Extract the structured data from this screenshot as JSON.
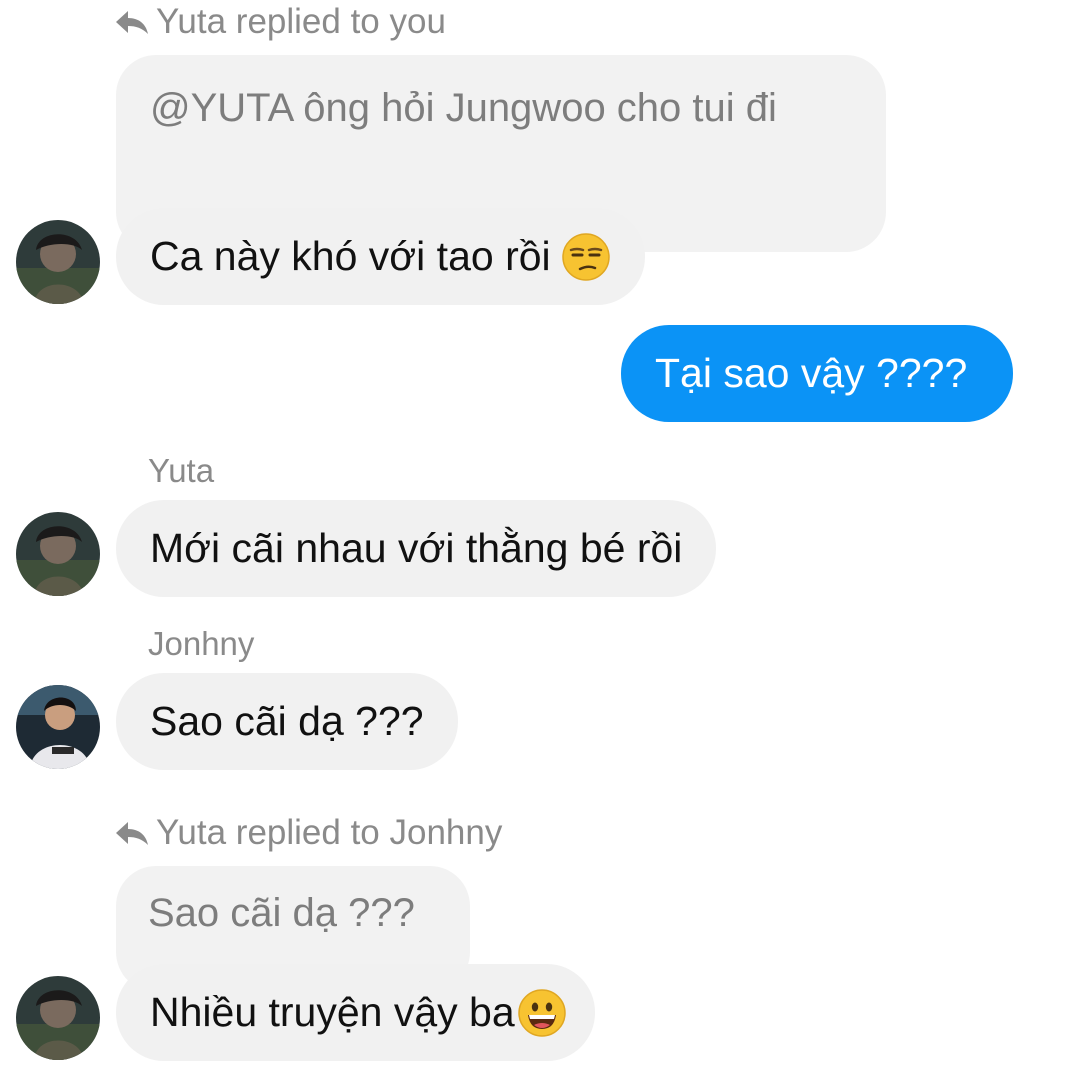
{
  "messages": {
    "m1_reply_meta": "Yuta replied to you",
    "m1_quote": "@YUTA ông hỏi Jungwoo cho tui đi",
    "m1_text": "Ca này khó với tao rồi",
    "m1_emoji": "unamused-face-emoji",
    "m2_text": "Tại sao vậy ????",
    "m3_sender": "Yuta",
    "m3_text": "Mới cãi nhau với thằng bé rồi",
    "m4_sender": "Jonhny",
    "m4_text": "Sao cãi dạ ???",
    "m5_reply_meta": "Yuta replied to Jonhny",
    "m5_quote": "Sao cãi dạ ???",
    "m5_text": "Nhiều truyện vậy ba",
    "m5_emoji": "grinning-face-emoji"
  },
  "colors": {
    "sent_bubble": "#0b93f6",
    "received_bubble": "#f1f1f1",
    "quote_bubble": "#f2f2f2",
    "meta_text": "#8a8a8a"
  },
  "icons": {
    "reply": "reply-arrow-icon",
    "avatar_yuta": "avatar-yuta",
    "avatar_jonhny": "avatar-jonhny"
  }
}
